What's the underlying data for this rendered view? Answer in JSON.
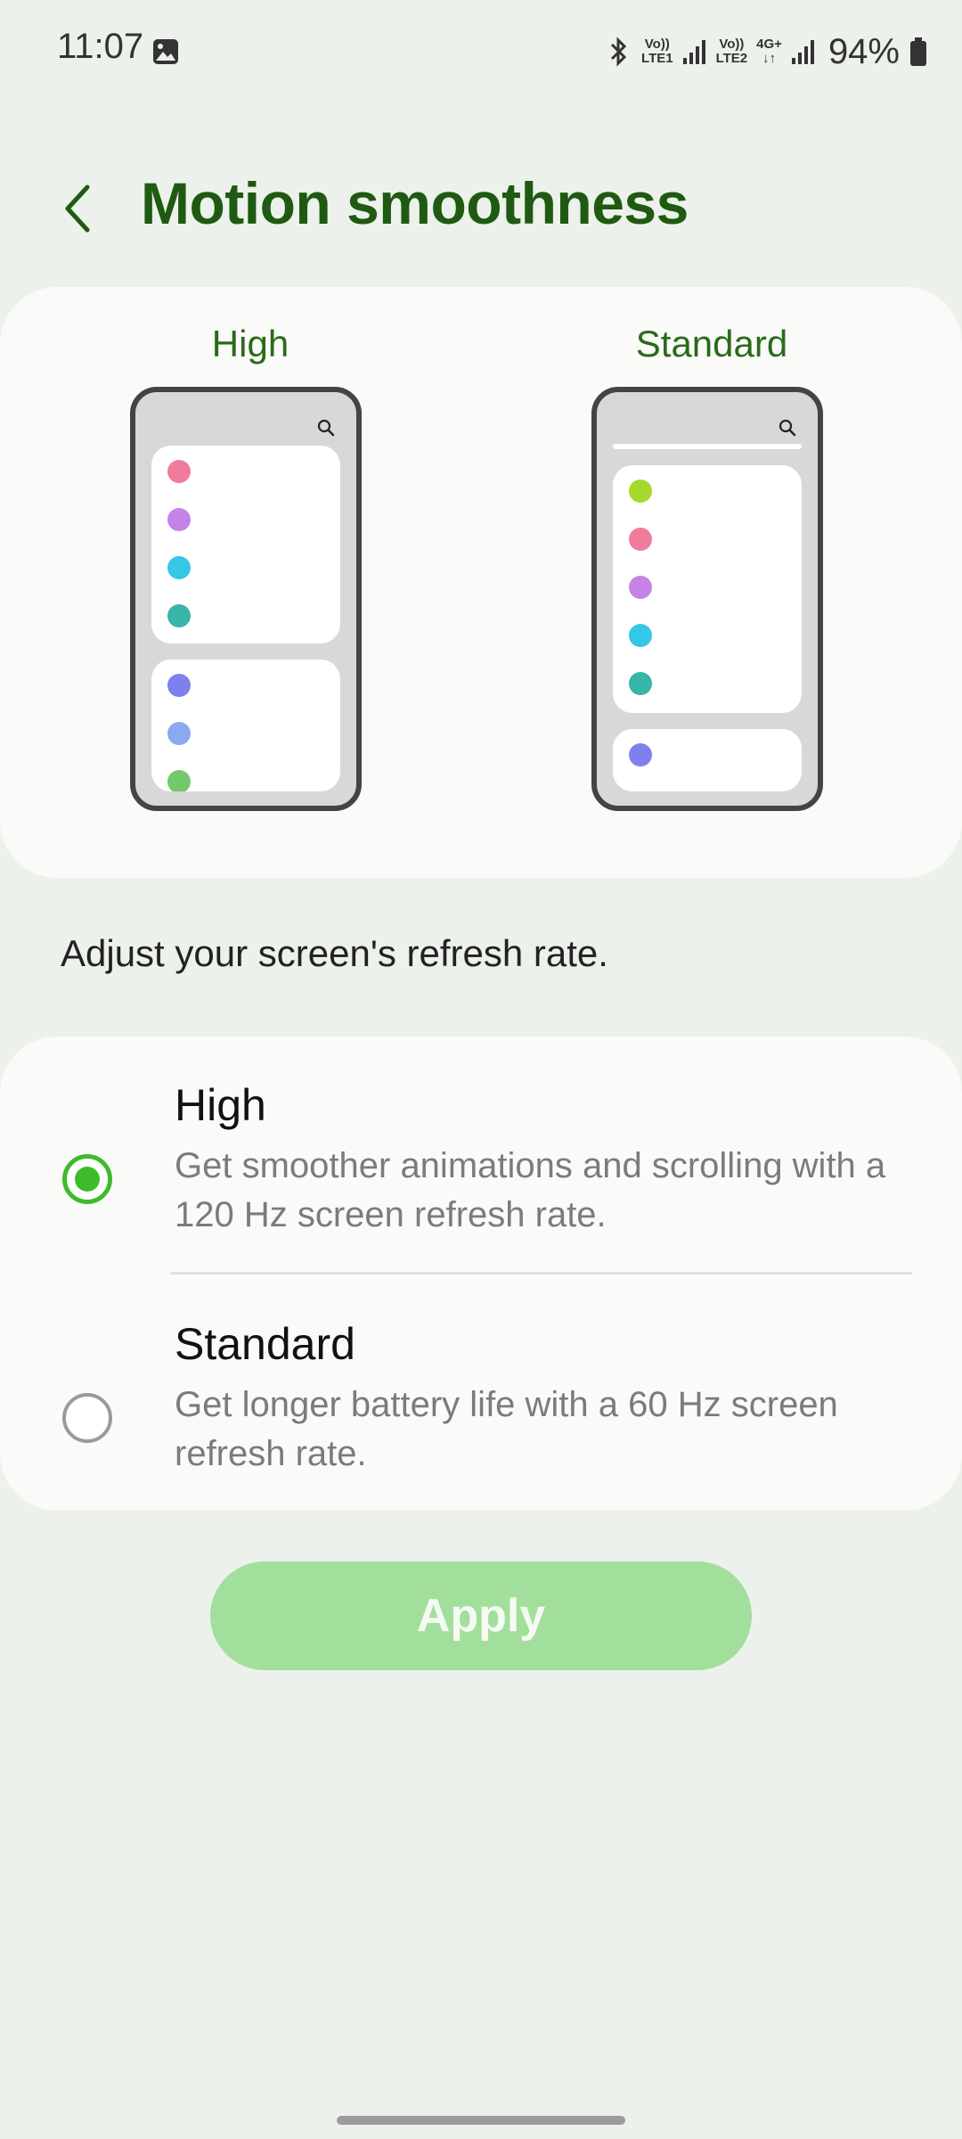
{
  "status_bar": {
    "time": "11:07",
    "sim1_label_top": "Vo))",
    "sim1_label_bottom": "LTE1",
    "sim2_label_top": "Vo))",
    "sim2_label_bottom": "LTE2",
    "network_type": "4G+",
    "battery_percent": "94%",
    "icons": [
      "gallery-icon",
      "bluetooth-icon",
      "signal-icon",
      "signal-icon",
      "data-arrows-icon",
      "battery-icon"
    ]
  },
  "header": {
    "title": "Motion smoothness",
    "back_icon": "chevron-left-icon"
  },
  "preview": {
    "high_label": "High",
    "standard_label": "Standard",
    "high_dot_colors": [
      "#f07c9b",
      "#c683e6",
      "#35c7e6",
      "#36b5a8",
      "#7f80ef",
      "#8aa9f0",
      "#73c86a"
    ],
    "standard_dot_colors": [
      "#a6d92c",
      "#f07c9b",
      "#c683e6",
      "#35c7e6",
      "#36b5a8",
      "#7f80ef"
    ]
  },
  "description": "Adjust your screen's refresh rate.",
  "options": [
    {
      "title": "High",
      "description": "Get smoother animations and scrolling with a 120 Hz screen refresh rate.",
      "selected": true
    },
    {
      "title": "Standard",
      "description": "Get longer battery life with a 60 Hz screen refresh rate.",
      "selected": false
    }
  ],
  "apply_label": "Apply",
  "colors": {
    "accent": "#3fba2d",
    "title_green": "#1f5a12",
    "apply_bg": "#a2df9c",
    "page_bg": "#edf1eb"
  }
}
